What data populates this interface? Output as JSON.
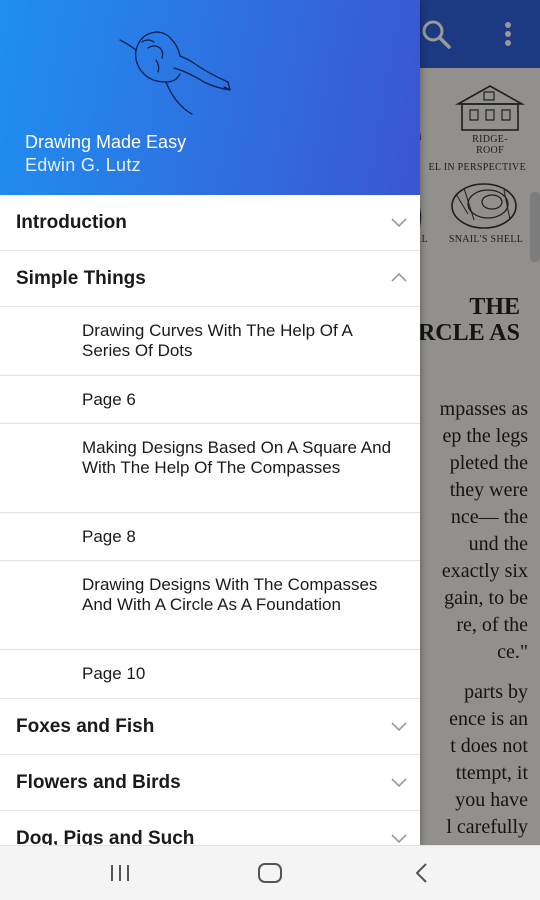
{
  "drawer": {
    "title": "Drawing Made Easy",
    "author": "Edwin G. Lutz",
    "sections": [
      {
        "label": "Introduction",
        "expanded": false
      },
      {
        "label": "Simple Things",
        "expanded": true,
        "items": [
          {
            "label": "Drawing Curves With The Help Of A Series Of Dots"
          },
          {
            "label": "Page 6"
          },
          {
            "label": "Making Designs Based On A Square And With The Help Of The Compasses"
          },
          {
            "label": "Page 8"
          },
          {
            "label": "Drawing Designs With The Compasses And With A Circle As A Foundation"
          },
          {
            "label": "Page 10"
          }
        ]
      },
      {
        "label": "Foxes and Fish",
        "expanded": false
      },
      {
        "label": "Flowers and Birds",
        "expanded": false
      },
      {
        "label": "Dog, Pigs and Such",
        "expanded": false
      }
    ]
  },
  "reader": {
    "captions": {
      "ridge_roof": "RIDGE-\nROOF",
      "perspective": "EL IN PERSPECTIVE",
      "spiral": "AL",
      "snails_shell": "SNAIL'S SHELL"
    },
    "heading": [
      "THE",
      "RCLE AS"
    ],
    "paragraph1": [
      "mpasses as",
      "ep the legs",
      "pleted the",
      "they were",
      "nce— the",
      "und the",
      "exactly six",
      "gain, to be",
      "re, of the",
      "ce.\""
    ],
    "paragraph2": [
      "parts by",
      "ence is an",
      "t does not",
      "ttempt, it",
      "you have",
      "l carefully"
    ]
  },
  "colors": {
    "header_gradient_start": "#1e8ff0",
    "header_gradient_end": "#3a55cf",
    "app_bar": "#2f5fd8"
  },
  "icons": {
    "app_bar": [
      "search-icon",
      "more-vert-icon"
    ],
    "system_nav": [
      "recents-icon",
      "home-icon",
      "back-icon"
    ],
    "section_toggle": [
      "chevron-down-icon",
      "chevron-up-icon"
    ]
  }
}
